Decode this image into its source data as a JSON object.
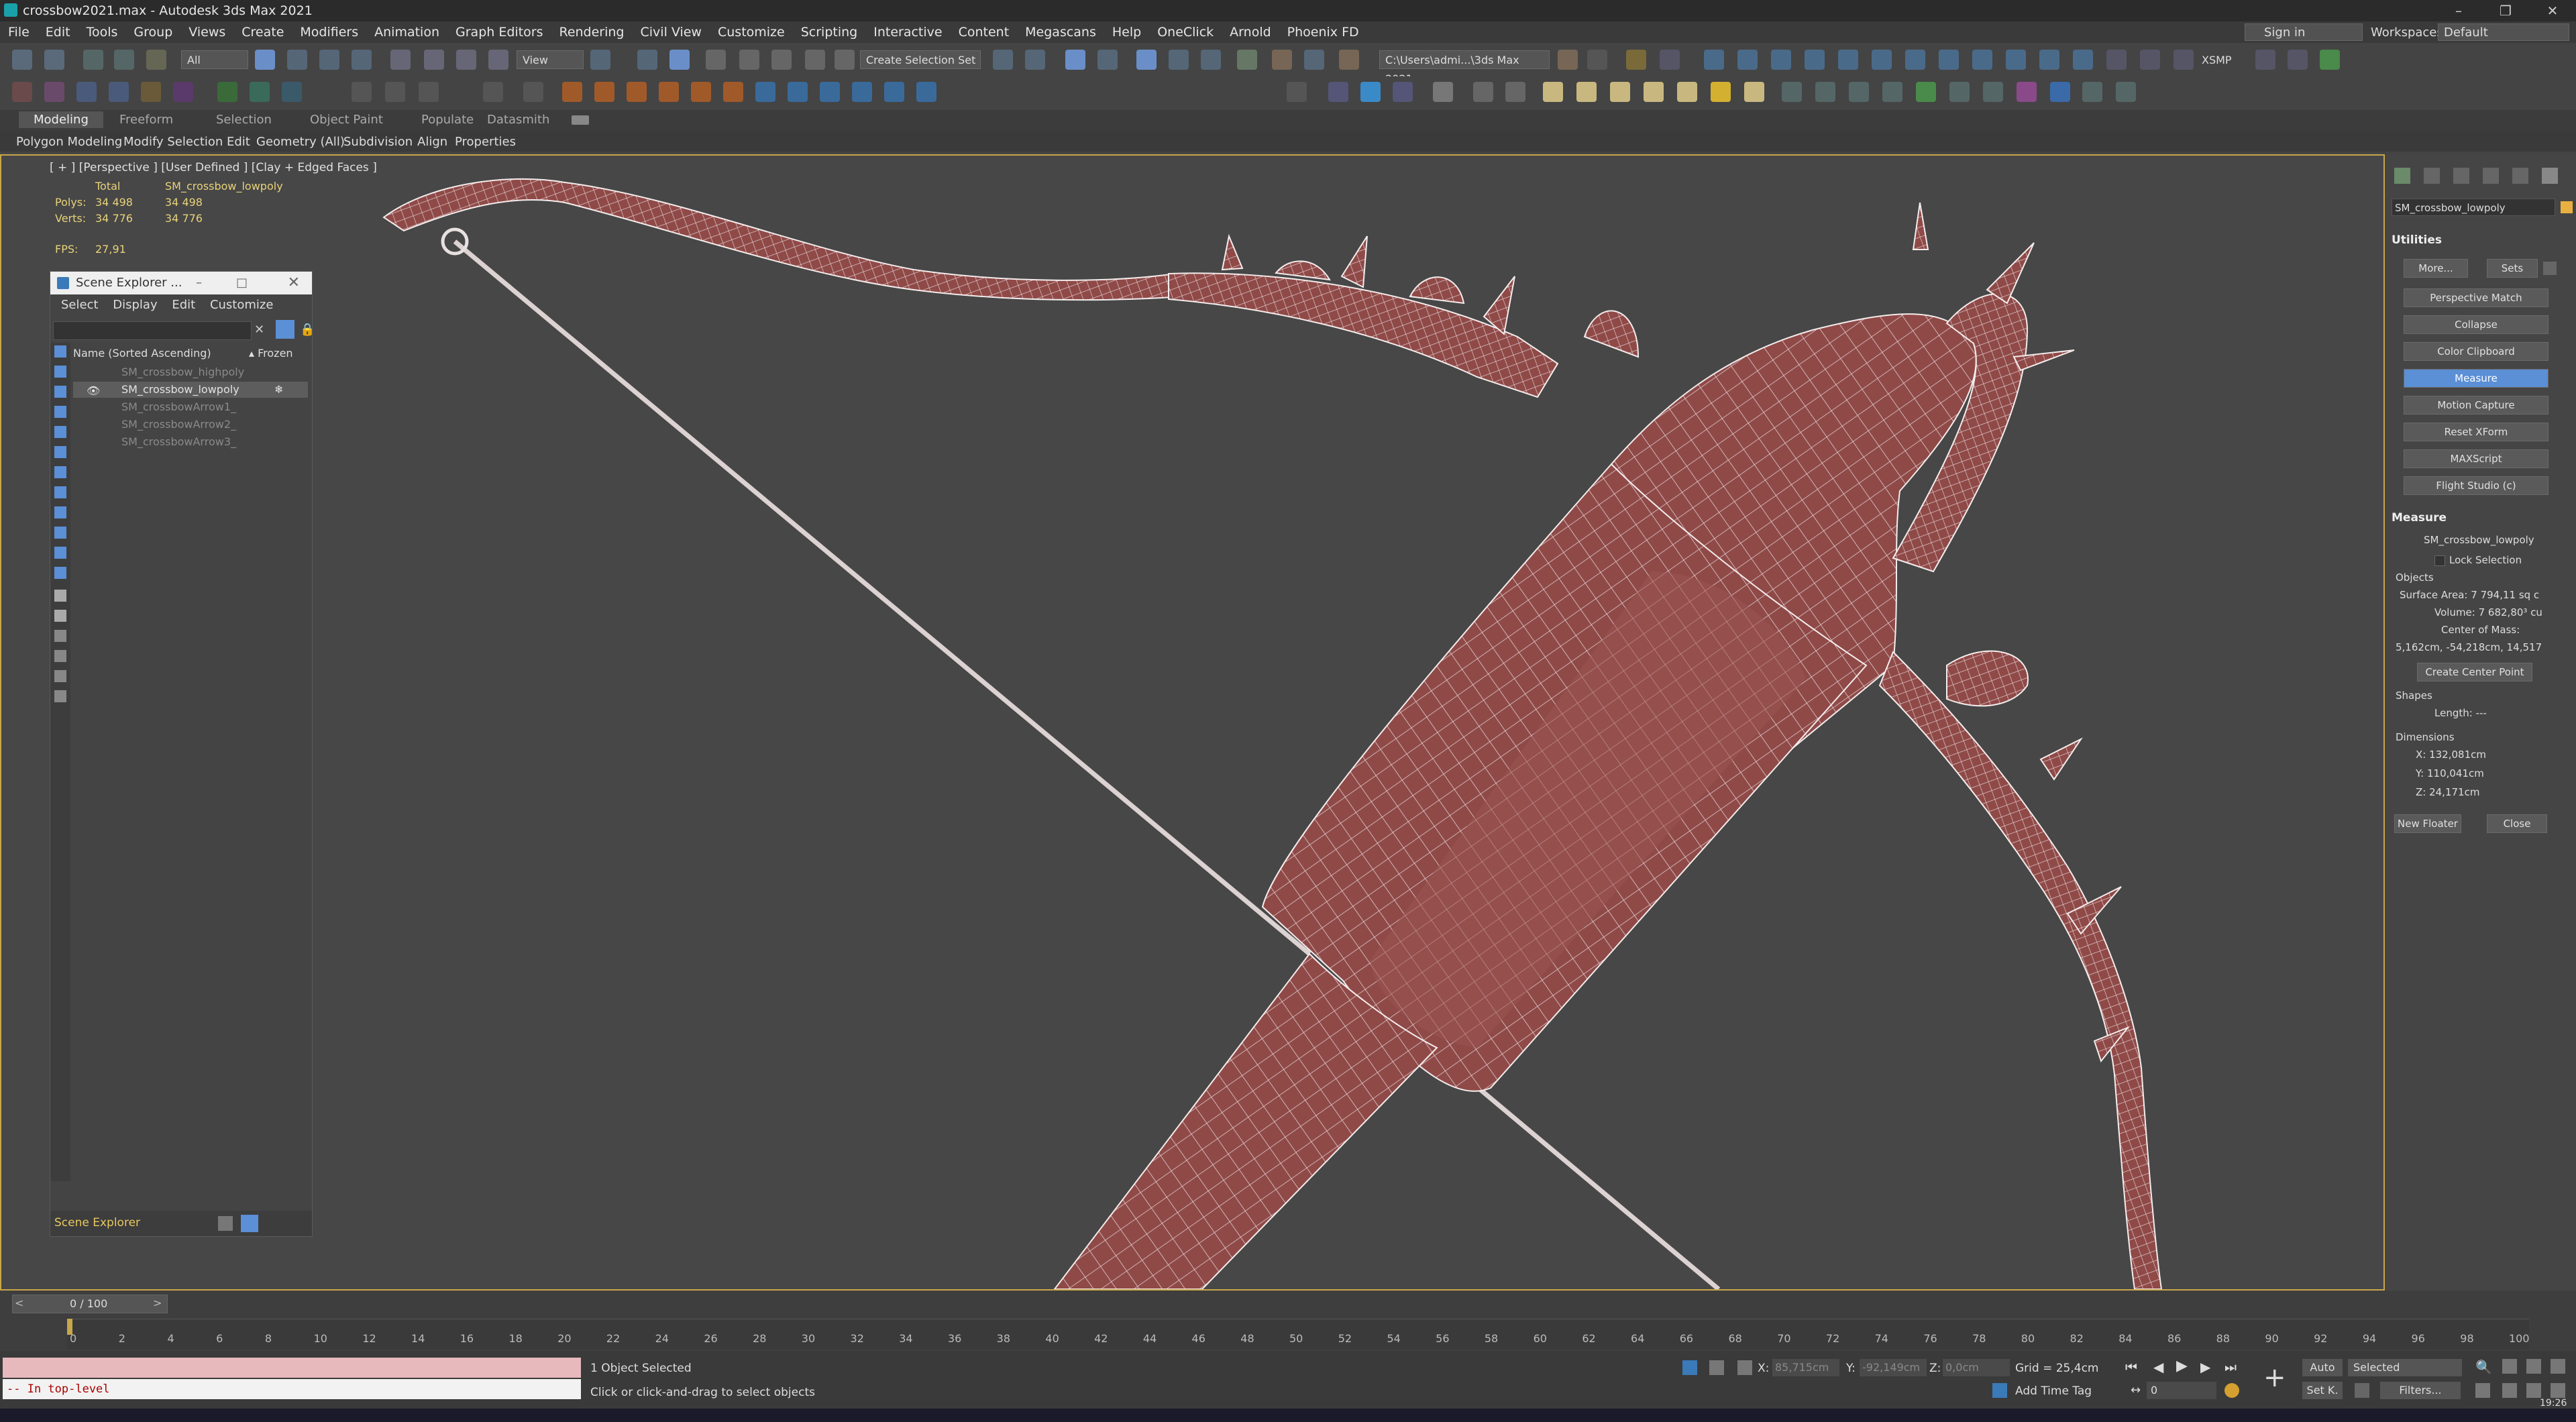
{
  "window": {
    "title": "crossbow2021.max - Autodesk 3ds Max 2021"
  },
  "menu": [
    "File",
    "Edit",
    "Tools",
    "Group",
    "Views",
    "Create",
    "Modifiers",
    "Animation",
    "Graph Editors",
    "Rendering",
    "Civil View",
    "Customize",
    "Scripting",
    "Interactive",
    "Content",
    "Megascans",
    "Help",
    "OneClick",
    "Arnold",
    "Phoenix FD"
  ],
  "account": {
    "sign_in": "Sign in",
    "workspaces_label": "Workspaces:",
    "workspace": "Default"
  },
  "toolbar": {
    "filter": "All",
    "refcoord": "View",
    "selection_set": "Create Selection Set",
    "path": "C:\\Users\\admi...\\3ds Max 2021",
    "xsmp": "XSMP"
  },
  "ribbon": {
    "tabs": [
      "Modeling",
      "Freeform",
      "Selection",
      "Object Paint",
      "Populate",
      "Datasmith"
    ],
    "subtabs": [
      "Polygon Modeling",
      "Modify Selection",
      "Edit",
      "Geometry (All)",
      "Subdivision",
      "Align",
      "Properties"
    ]
  },
  "viewport": {
    "label": "[ + ] [Perspective ] [User Defined ] [Clay + Edged Faces ]",
    "stats_total": "Total",
    "stats_object": "SM_crossbow_lowpoly",
    "polys_label": "Polys:",
    "polys_total": "34 498",
    "polys_obj": "34 498",
    "verts_label": "Verts:",
    "verts_total": "34 776",
    "verts_obj": "34 776",
    "fps_label": "FPS:",
    "fps_value": "27,91",
    "model_color": "#8f4a48",
    "wire_color": "#f0e6e6"
  },
  "scene_explorer": {
    "title": "Scene Explorer ...",
    "menu": [
      "Select",
      "Display",
      "Edit",
      "Customize"
    ],
    "col_name": "Name (Sorted Ascending)",
    "col_frozen": "▴ Frozen",
    "rows": [
      "SM_crossbow_highpoly",
      "SM_crossbow_lowpoly",
      "SM_crossbowArrow1_",
      "SM_crossbowArrow2_",
      "SM_crossbowArrow3_"
    ],
    "footer": "Scene Explorer"
  },
  "command_panel": {
    "object_name": "SM_crossbow_lowpoly",
    "utilities_title": "Utilities",
    "more": "More...",
    "sets": "Sets",
    "buttons": [
      "Perspective Match",
      "Collapse",
      "Color Clipboard",
      "Measure",
      "Motion Capture",
      "Reset XForm",
      "MAXScript",
      "Flight Studio (c)"
    ],
    "measure_title": "Measure",
    "measure_object": "SM_crossbow_lowpoly",
    "lock_selection": "Lock Selection",
    "objects_label": "Objects",
    "surface_area": "Surface Area: 7 794,11 sq c",
    "volume": "Volume: 7 682,80³ cu",
    "center_of_mass_label": "Center of Mass:",
    "center_of_mass": "5,162cm, -54,218cm, 14,517",
    "create_center_point": "Create Center Point",
    "shapes_label": "Shapes",
    "length": "Length: ---",
    "dimensions_label": "Dimensions",
    "dim_x": "X:  132,081cm",
    "dim_y": "Y:  110,041cm",
    "dim_z": "Z:  24,171cm",
    "new_floater": "New Floater",
    "close": "Close"
  },
  "timeline": {
    "frame": "0 / 100",
    "ticks": [
      "0",
      "2",
      "4",
      "6",
      "8",
      "10",
      "12",
      "14",
      "16",
      "18",
      "20",
      "22",
      "24",
      "26",
      "28",
      "30",
      "32",
      "34",
      "36",
      "38",
      "40",
      "42",
      "44",
      "46",
      "48",
      "50",
      "52",
      "54",
      "56",
      "58",
      "60",
      "62",
      "64",
      "66",
      "68",
      "70",
      "72",
      "74",
      "76",
      "78",
      "80",
      "82",
      "84",
      "86",
      "88",
      "90",
      "92",
      "94",
      "96",
      "98",
      "100"
    ]
  },
  "status": {
    "maxscript": "-- In top-level",
    "selected": "1 Object Selected",
    "prompt": "Click or click-and-drag to select objects",
    "x_label": "X:",
    "x_val": "85,715cm",
    "y_label": "Y:",
    "y_val": "-92,149cm",
    "z_label": "Z:",
    "z_val": "0,0cm",
    "grid": "Grid = 25,4cm",
    "add_time_tag": "Add Time Tag",
    "auto": "Auto",
    "selected_dd": "Selected",
    "set_k": "Set K.",
    "filters": "Filters...",
    "frame_field": "0",
    "clock": "19:26"
  }
}
